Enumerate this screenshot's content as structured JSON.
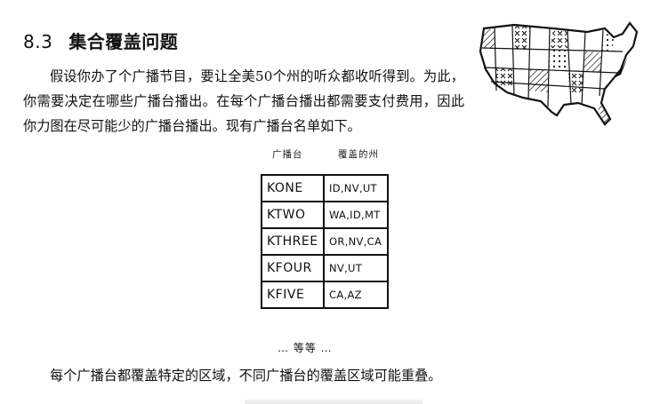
{
  "section": {
    "number": "8.3",
    "title": "集合覆盖问题"
  },
  "paragraphs": [
    "假设你办了个广播节目，要让全美50个州的听众都收听得到。为此，你需要决定在哪些广播台播出。在每个广播台播出都需要支付费用，因此你力图在尽可能少的广播台播出。现有广播台名单如下。",
    "每个广播台都覆盖特定的区域，不同广播台的覆盖区域可能重叠。"
  ],
  "table": {
    "headers": [
      "广播台",
      "覆盖的州"
    ],
    "rows": [
      {
        "station": "KONE",
        "states": "ID,NV,UT"
      },
      {
        "station": "KTWO",
        "states": "WA,ID,MT"
      },
      {
        "station": "KTHREE",
        "states": "OR,NV,CA"
      },
      {
        "station": "KFOUR",
        "states": "NV,UT"
      },
      {
        "station": "KFIVE",
        "states": "CA,AZ"
      }
    ],
    "ellipsis": "… 等等 …"
  },
  "illustration": {
    "icon": "usa-map-icon"
  }
}
